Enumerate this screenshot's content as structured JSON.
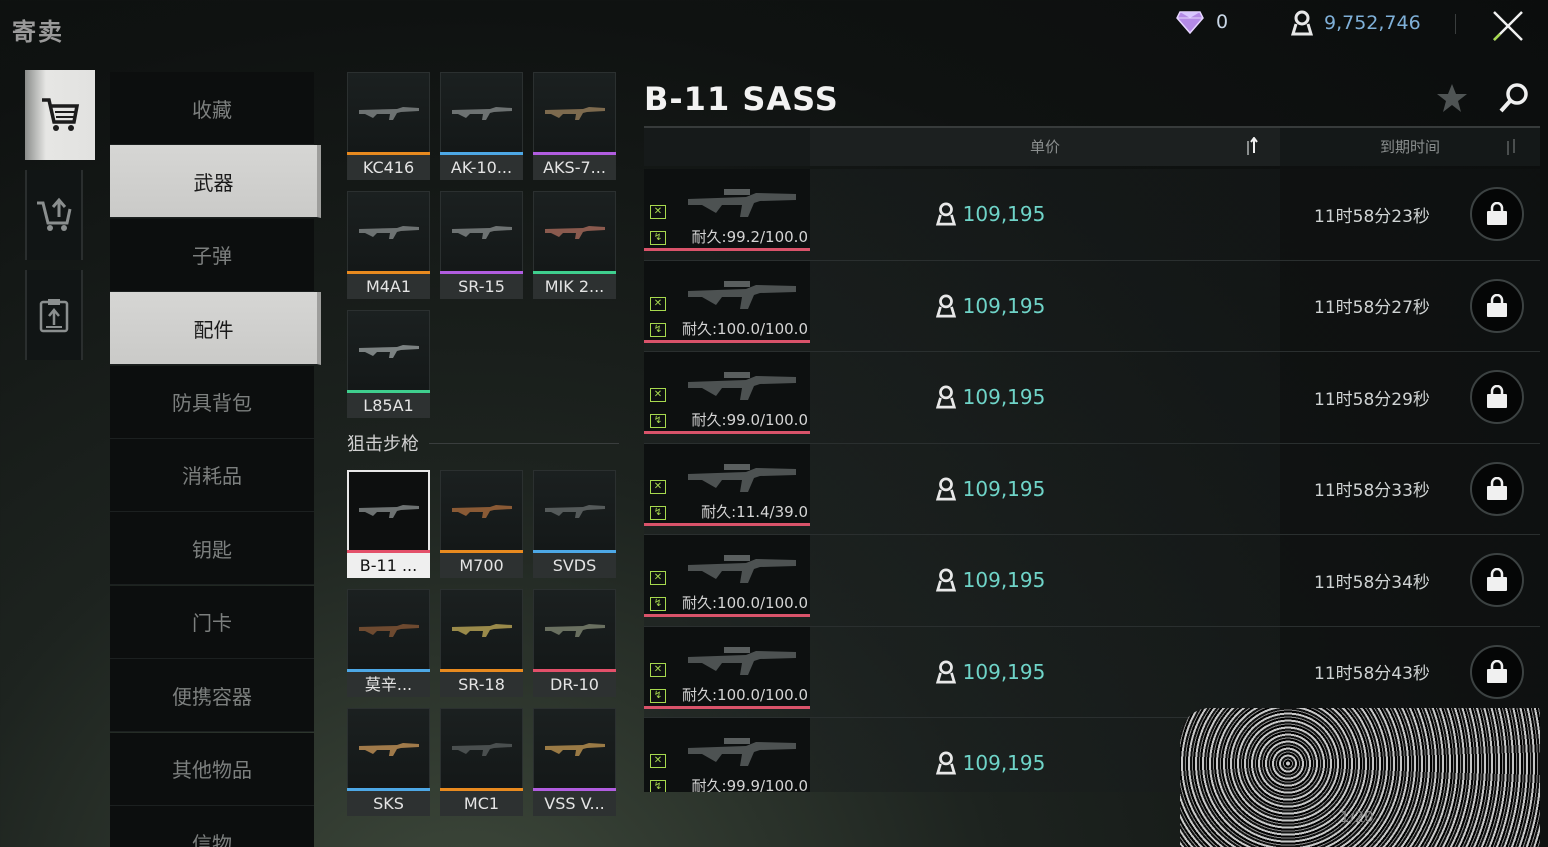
{
  "window": {
    "title": "寄卖"
  },
  "currency": {
    "gems": "0",
    "coins": "9,752,746"
  },
  "rail": [
    {
      "name": "shopping-cart-icon",
      "active": true
    },
    {
      "name": "sell-cart-icon",
      "active": false
    },
    {
      "name": "clipboard-list-icon",
      "active": false
    }
  ],
  "categories": [
    {
      "label": "收藏",
      "active": false
    },
    {
      "label": "武器",
      "active": true
    },
    {
      "label": "子弹",
      "active": false
    },
    {
      "label": "配件",
      "active": true
    },
    {
      "label": "防具背包",
      "active": false
    },
    {
      "label": "消耗品",
      "active": false
    },
    {
      "label": "钥匙",
      "active": false
    },
    {
      "label": "门卡",
      "active": false
    },
    {
      "label": "便携容器",
      "active": false
    },
    {
      "label": "其他物品",
      "active": false
    },
    {
      "label": "信物",
      "active": false
    }
  ],
  "weapons_top": [
    {
      "label": "KC416",
      "rarity": "#e88a1f"
    },
    {
      "label": "AK-10...",
      "rarity": "#4da8e6"
    },
    {
      "label": "AKS-7...",
      "rarity": "#b15de0"
    },
    {
      "label": "M4A1",
      "rarity": "#e88a1f"
    },
    {
      "label": "SR-15",
      "rarity": "#b15de0"
    },
    {
      "label": "MIK 2...",
      "rarity": "#3fcf8e"
    },
    {
      "label": "L85A1",
      "rarity": "#3fcf8e"
    }
  ],
  "sniper_section": {
    "title": "狙击步枪"
  },
  "weapons_sniper": [
    {
      "label": "B-11 ...",
      "rarity": "#e3506a",
      "selected": true
    },
    {
      "label": "M700",
      "rarity": "#e88a1f"
    },
    {
      "label": "SVDS",
      "rarity": "#4da8e6"
    },
    {
      "label": "莫辛...",
      "rarity": "#4da8e6"
    },
    {
      "label": "SR-18",
      "rarity": "#e88a1f"
    },
    {
      "label": "DR-10",
      "rarity": "#e3506a"
    },
    {
      "label": "SKS",
      "rarity": "#4da8e6"
    },
    {
      "label": "MC1",
      "rarity": "#e88a1f"
    },
    {
      "label": "VSS V...",
      "rarity": "#b15de0"
    }
  ],
  "detail": {
    "item_name": "B-11 SASS",
    "col_price": "单价",
    "col_expire": "到期时间"
  },
  "listings": [
    {
      "durability": "耐久:99.2/100.0",
      "price": "109,195",
      "time": "11时58分23秒"
    },
    {
      "durability": "耐久:100.0/100.0",
      "price": "109,195",
      "time": "11时58分27秒"
    },
    {
      "durability": "耐久:99.0/100.0",
      "price": "109,195",
      "time": "11时58分29秒"
    },
    {
      "durability": "耐久:11.4/39.0",
      "price": "109,195",
      "time": "11时58分33秒"
    },
    {
      "durability": "耐久:100.0/100.0",
      "price": "109,195",
      "time": "11时58分34秒"
    },
    {
      "durability": "耐久:100.0/100.0",
      "price": "109,195",
      "time": "11时58分43秒"
    },
    {
      "durability": "耐久:99.9/100.0",
      "price": "109,195",
      "time": ""
    }
  ],
  "pager": {
    "text": "1/20"
  },
  "colors": {
    "price": "#6fd4c8",
    "durability_bar": "#d9536a",
    "accent_green": "#a7d94e"
  }
}
